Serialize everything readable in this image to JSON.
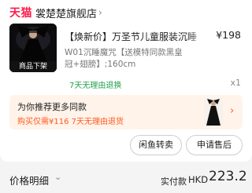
{
  "shop": {
    "logo_text": "天猫",
    "name": "裳楚楚旗舰店",
    "arrow": "›"
  },
  "product": {
    "title": "【焕新价】万圣节儿童服装沉睡",
    "price": "¥198",
    "spec_line1": "W01沉睡魔咒【送模特同款黑皇",
    "spec_line2": "冠+翅膀】;160cm",
    "image_tag": "商品下架",
    "return_policy": "7天无理由退换",
    "quantity": "x1"
  },
  "recommendation": {
    "title": "为你推荐更多同款",
    "subtitle": "购买仅需¥116  7天无理由退货",
    "arrow": "›"
  },
  "buttons": {
    "xianyu": "闲鱼转卖",
    "after_sale": "申请售后"
  },
  "footer": {
    "price_detail_label": "价格明细",
    "price_detail_chevron": "⌄",
    "paid_label": "实付款",
    "currency": "HKD",
    "amount": "223.2"
  },
  "colors": {
    "brand": "#ff1a4a",
    "green": "#22a04a",
    "orange": "#ff5a1f",
    "rec_bg": "#fff3ea"
  }
}
